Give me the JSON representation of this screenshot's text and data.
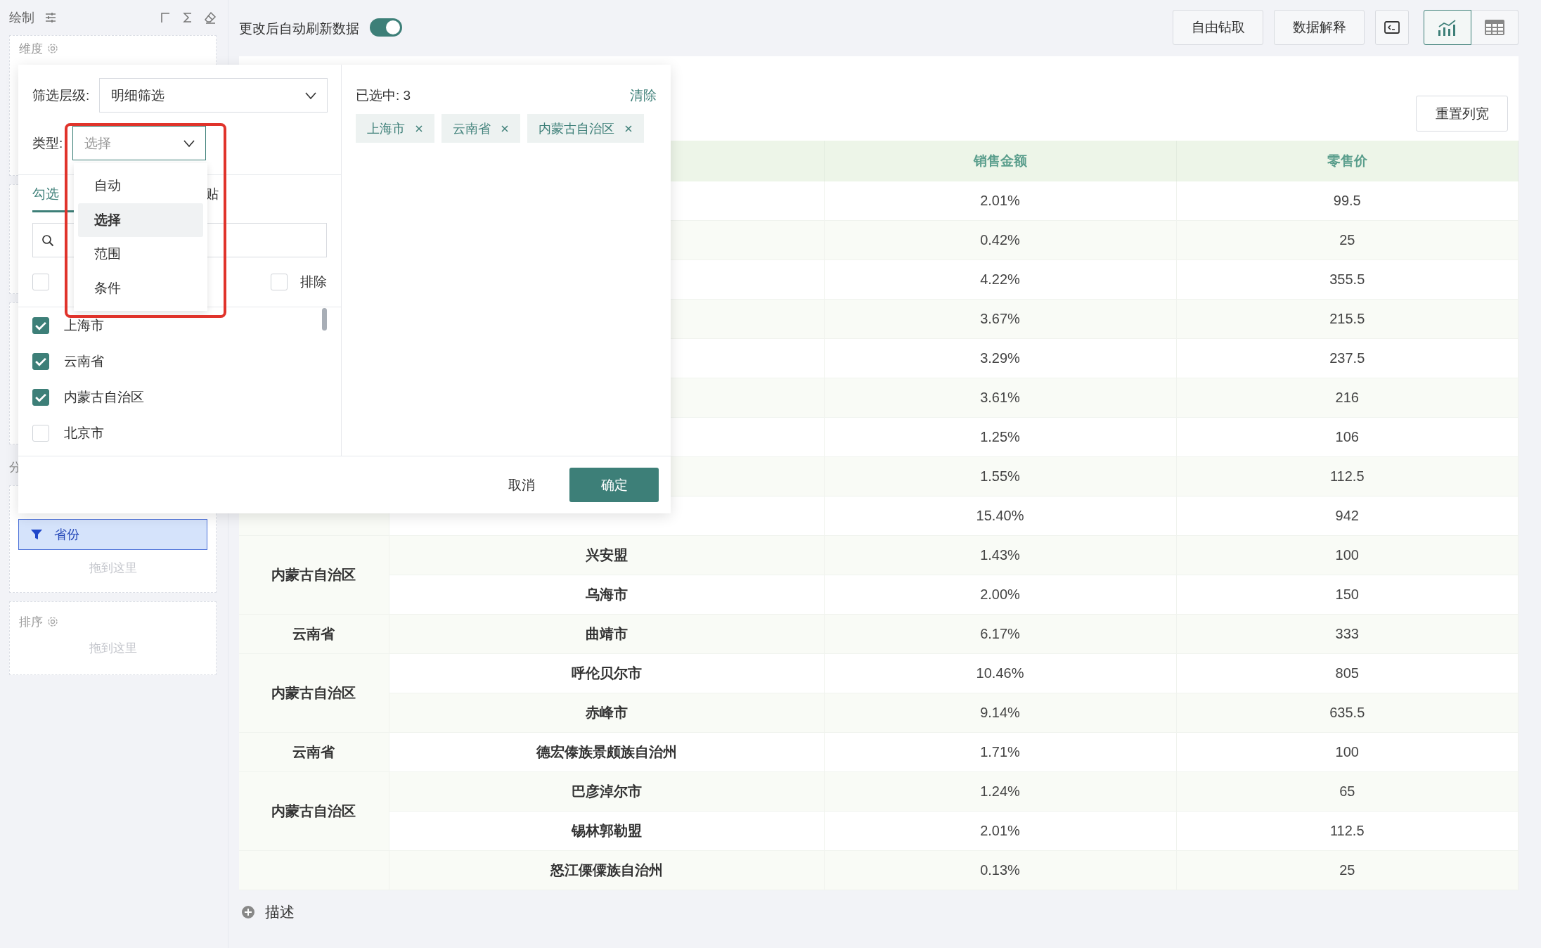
{
  "sidebar": {
    "title": "绘制",
    "dimension_label": "维度",
    "section_label": "分",
    "filter_pill": "省份",
    "filter_drop_hint": "拖到这里",
    "sort_label": "排序",
    "sort_drop_hint": "拖到这里"
  },
  "toolbar": {
    "auto_refresh_label": "更改后自动刷新数据",
    "auto_refresh_on": true,
    "buttons": [
      "自由钻取",
      "数据解释"
    ],
    "views": [
      {
        "kind": "console",
        "selected": false
      },
      {
        "kind": "chart",
        "selected": true
      },
      {
        "kind": "table",
        "selected": false
      }
    ]
  },
  "table": {
    "reset_width_button": "重置列宽",
    "headers": [
      "销售金额",
      "零售价"
    ],
    "groups": [
      {
        "rows": [
          {
            "sales": "2.01%",
            "price": "99.5"
          },
          {
            "sales": "0.42%",
            "price": "25"
          },
          {
            "sales": "4.22%",
            "price": "355.5"
          },
          {
            "sales": "3.67%",
            "price": "215.5"
          },
          {
            "sales": "3.29%",
            "price": "237.5"
          },
          {
            "sales": "3.61%",
            "price": "216"
          },
          {
            "sales": "1.25%",
            "price": "106"
          },
          {
            "sales": "1.55%",
            "price": "112.5"
          },
          {
            "sales": "15.40%",
            "price": "942"
          }
        ]
      },
      {
        "province": "内蒙古自治区",
        "rows": [
          {
            "city": "兴安盟",
            "sales": "1.43%",
            "price": "100"
          },
          {
            "city": "乌海市",
            "sales": "2.00%",
            "price": "150"
          }
        ]
      },
      {
        "province": "云南省",
        "rows": [
          {
            "city": "曲靖市",
            "sales": "6.17%",
            "price": "333"
          }
        ]
      },
      {
        "province": "内蒙古自治区",
        "rows": [
          {
            "city": "呼伦贝尔市",
            "sales": "10.46%",
            "price": "805"
          },
          {
            "city": "赤峰市",
            "sales": "9.14%",
            "price": "635.5"
          }
        ]
      },
      {
        "province": "云南省",
        "rows": [
          {
            "city": "德宏傣族景颇族自治州",
            "sales": "1.71%",
            "price": "100"
          }
        ]
      },
      {
        "province": "内蒙古自治区",
        "rows": [
          {
            "city": "巴彦淖尔市",
            "sales": "1.24%",
            "price": "65"
          },
          {
            "city": "锡林郭勒盟",
            "sales": "2.01%",
            "price": "112.5"
          }
        ]
      },
      {
        "rows": [
          {
            "city": "怒江傈僳族自治州",
            "sales": "0.13%",
            "price": "25"
          }
        ]
      }
    ]
  },
  "description_label": "描述",
  "filter_dialog": {
    "level_label": "筛选层级:",
    "level_value": "明细筛选",
    "type_label": "类型:",
    "type_value": "选择",
    "type_menu": [
      {
        "label": "自动",
        "selected": false
      },
      {
        "label": "选择",
        "selected": true
      },
      {
        "label": "范围",
        "selected": false
      },
      {
        "label": "条件",
        "selected": false
      }
    ],
    "tabs": [
      {
        "label": "勾选",
        "selected": true
      },
      {
        "label": "贴",
        "selected": false
      }
    ],
    "select_all_checked": false,
    "exclude_label": "排除",
    "exclude_checked": false,
    "items": [
      {
        "label": "上海市",
        "checked": true
      },
      {
        "label": "云南省",
        "checked": true
      },
      {
        "label": "内蒙古自治区",
        "checked": true
      },
      {
        "label": "北京市",
        "checked": false
      }
    ],
    "selected_count_label": "已选中: 3",
    "clear_link": "清除",
    "tags": [
      "上海市",
      "云南省",
      "内蒙古自治区"
    ],
    "cancel_button": "取消",
    "confirm_button": "确定"
  }
}
